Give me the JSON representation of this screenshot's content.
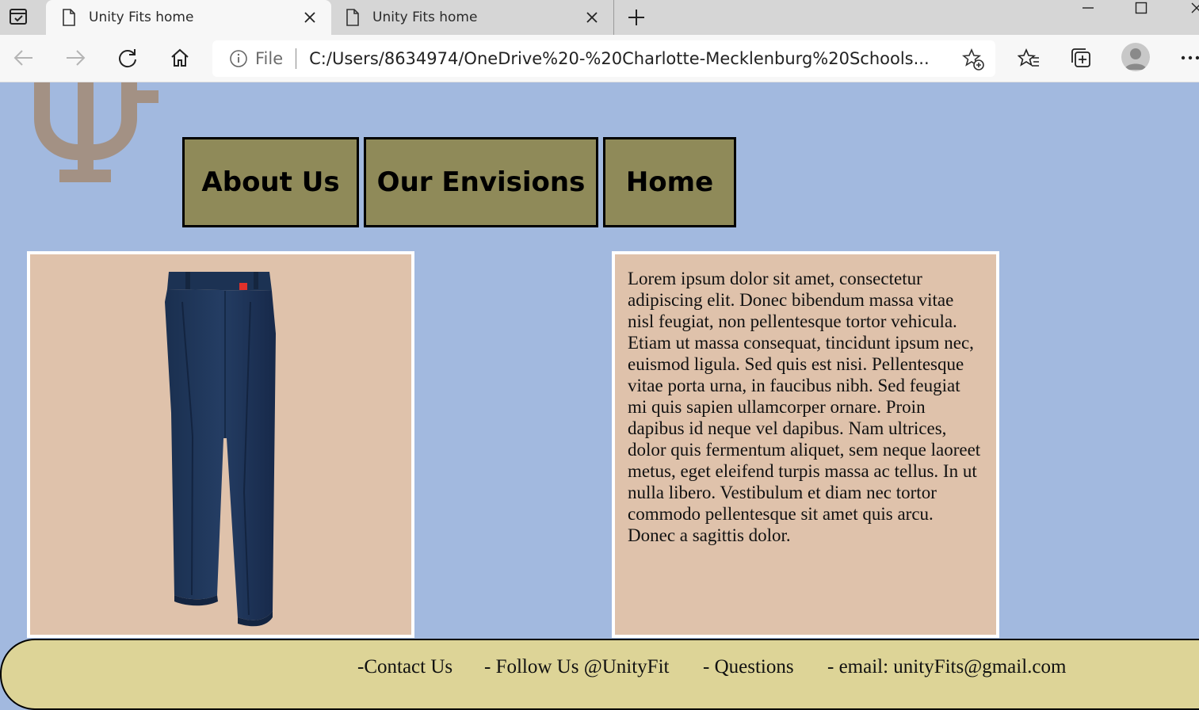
{
  "browser": {
    "tabs": [
      {
        "title": "Unity Fits home"
      },
      {
        "title": "Unity Fits home"
      }
    ],
    "address": {
      "scheme_label": "File",
      "url": "C:/Users/8634974/OneDrive%20-%20Charlotte-Mecklenburg%20Schools..."
    }
  },
  "nav": {
    "items": [
      {
        "label": "About Us"
      },
      {
        "label": "Our Envisions"
      },
      {
        "label": "Home"
      }
    ]
  },
  "content": {
    "description": "Lorem ipsum dolor sit amet, consectetur adipiscing elit. Donec bibendum massa vitae nisl feugiat, non pellentesque tortor vehicula. Etiam ut massa consequat, tincidunt ipsum nec, euismod ligula. Sed quis est nisi. Pellentesque vitae porta urna, in faucibus nibh. Sed feugiat mi quis sapien ullamcorper ornare. Proin dapibus id neque vel dapibus. Nam ultrices, dolor quis fermentum aliquet, sem neque laoreet metus, eget eleifend turpis massa ac tellus. In ut nulla libero. Vestibulum et diam nec tortor commodo pellentesque sit amet quis arcu. Donec a sagittis dolor."
  },
  "footer": {
    "contact": "-Contact Us",
    "follow": "- Follow Us @UnityFit",
    "questions": "- Questions",
    "email": "- email: unityFits@gmail.com"
  },
  "colors": {
    "page_bg": "#a2b9df",
    "nav_bg": "#8f8a59",
    "panel_bg": "#dfc2ab",
    "footer_bg": "#ddd497",
    "logo": "#a39184",
    "pants": "#1f3557"
  }
}
